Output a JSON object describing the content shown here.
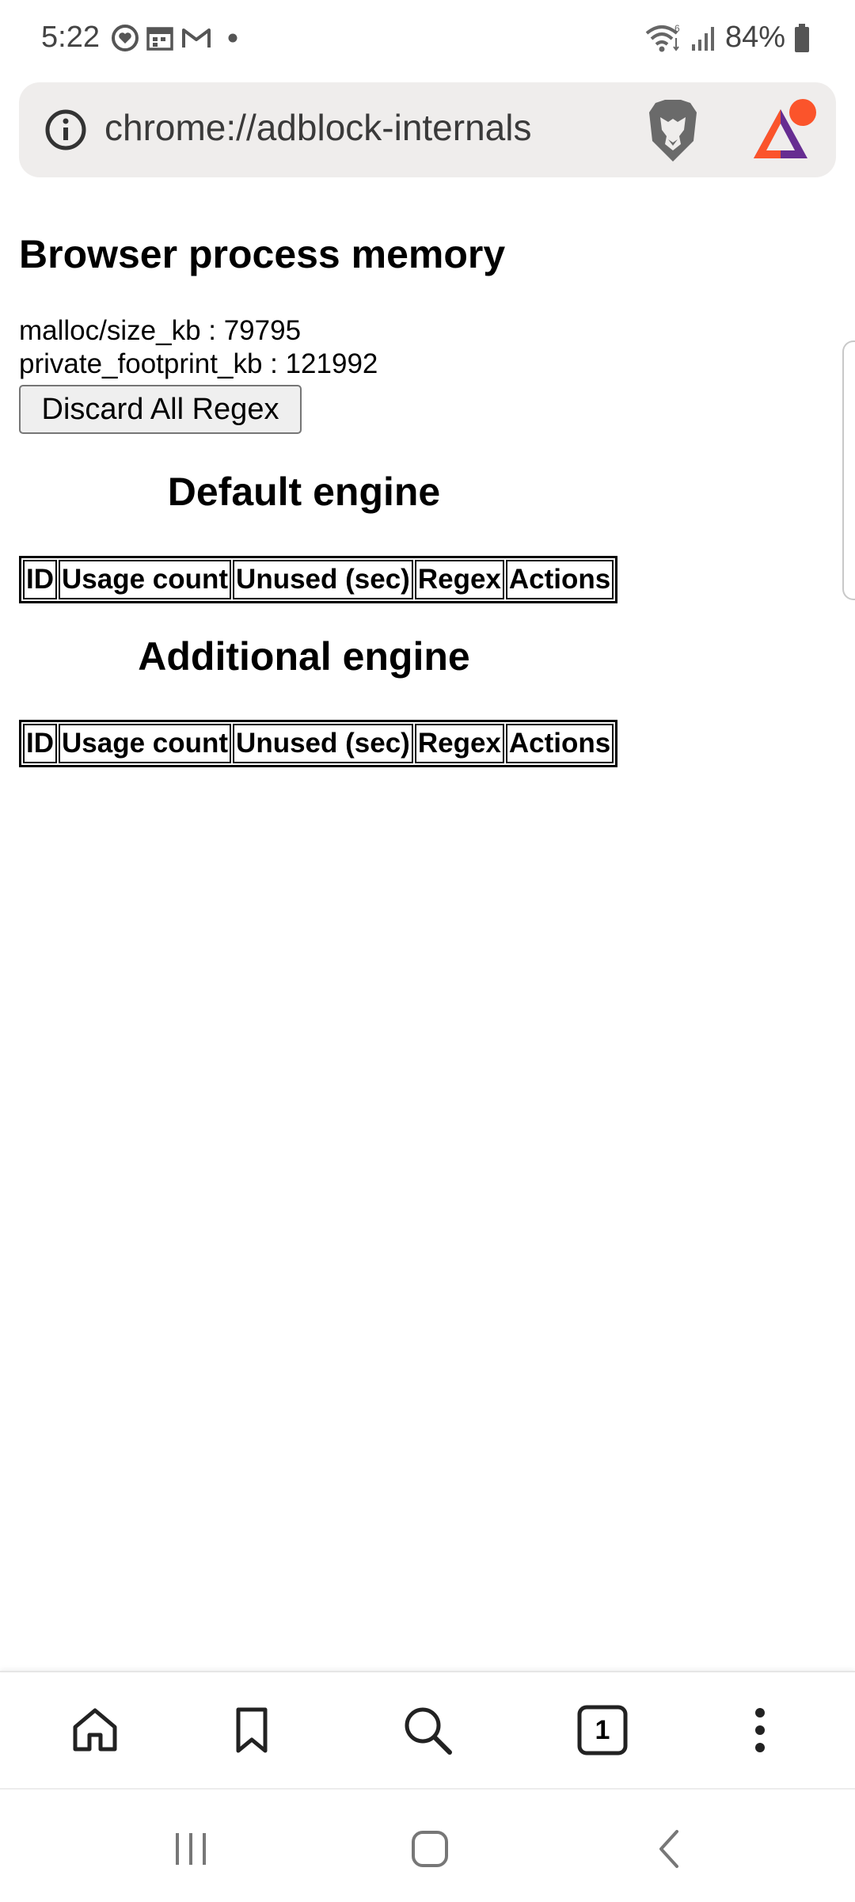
{
  "status_bar": {
    "time": "5:22",
    "battery_percent": "84%",
    "left_icons": [
      "heart-circle-icon",
      "calendar-icon",
      "gmail-icon",
      "notification-dot-icon"
    ],
    "right_icons": [
      "wifi-icon",
      "signal-icon",
      "battery-icon"
    ]
  },
  "address_bar": {
    "url": "chrome://adblock-internals",
    "icons": [
      "info-icon",
      "brave-shields-icon",
      "brave-rewards-icon"
    ]
  },
  "page": {
    "title": "Browser process memory",
    "memory_lines": [
      "malloc/size_kb : 79795",
      "private_footprint_kb : 121992"
    ],
    "discard_button_label": "Discard All Regex",
    "engines": [
      {
        "heading": "Default engine",
        "columns": [
          "ID",
          "Usage count",
          "Unused (sec)",
          "Regex",
          "Actions"
        ],
        "rows": []
      },
      {
        "heading": "Additional engine",
        "columns": [
          "ID",
          "Usage count",
          "Unused (sec)",
          "Regex",
          "Actions"
        ],
        "rows": []
      }
    ]
  },
  "bottom_toolbar": {
    "items": [
      "home-icon",
      "bookmark-icon",
      "search-icon",
      "tab-switcher-icon",
      "more-menu-icon"
    ],
    "tab_count": "1"
  },
  "nav_bar": {
    "items": [
      "recents-icon",
      "home-icon",
      "back-icon"
    ]
  },
  "colors": {
    "url_bar_bg": "#efedec",
    "button_bg": "#efefef",
    "bat_orange": "#fb542b",
    "bat_purple": "#662d91"
  }
}
